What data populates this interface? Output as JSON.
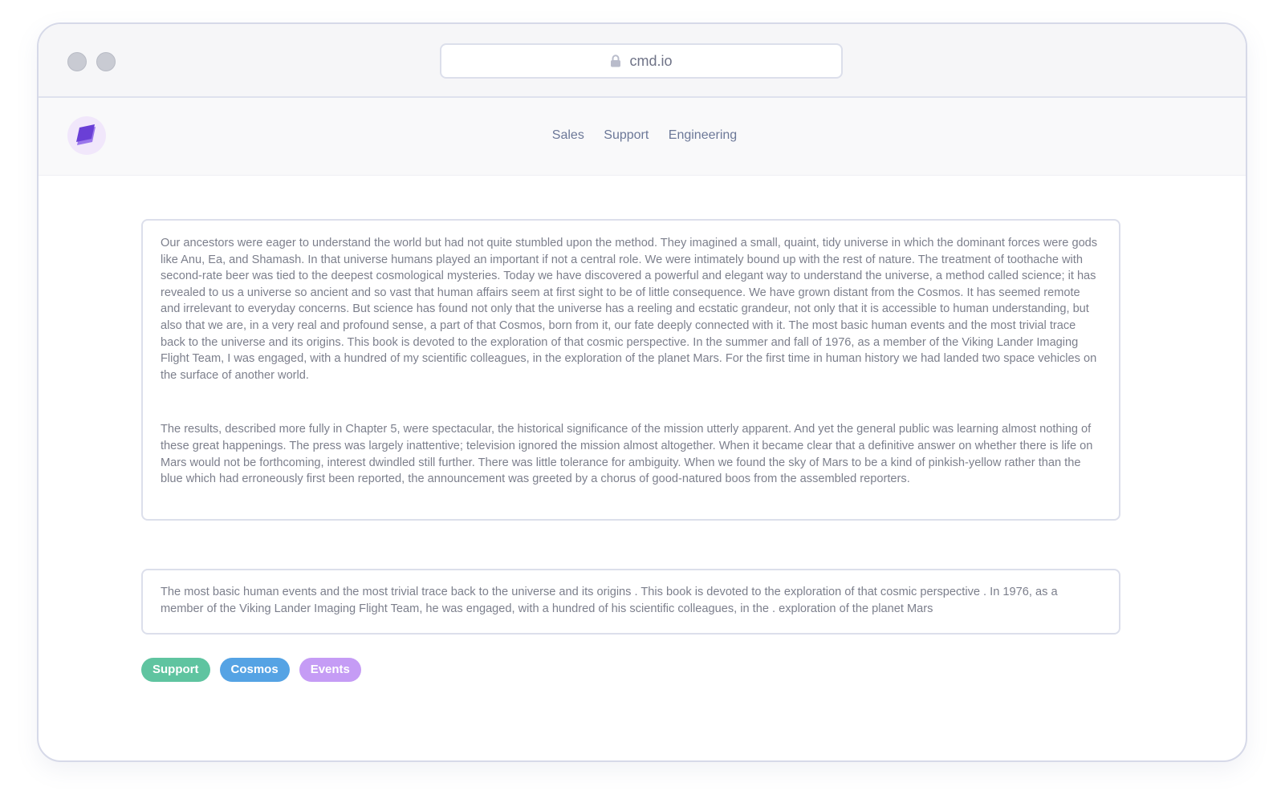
{
  "browser": {
    "url": "cmd.io"
  },
  "nav": {
    "links": [
      "Sales",
      "Support",
      "Engineering"
    ]
  },
  "content": {
    "paragraph1": "Our ancestors were eager to understand the world but had not quite stumbled upon the method. They imagined a small, quaint, tidy universe in which the dominant forces were gods like Anu, Ea, and Shamash. In that universe humans played an important if not a central role. We were intimately bound up with the rest of nature. The treatment of toothache with second-rate beer was tied to the deepest cosmological mysteries.  Today we have discovered a powerful and elegant way to understand the universe, a method called science; it has revealed to us a universe so ancient and so vast that human affairs seem at first sight to be of little consequence. We have grown distant from the Cosmos. It has seemed remote and irrelevant to everyday concerns. But science has found not only that the universe has a reeling and ecstatic grandeur, not only that it is accessible to human understanding, but also that we are, in a very real and profound sense, a part of that Cosmos, born from it, our fate deeply connected with it. The most basic human events and the most trivial trace back to the universe and its origins. This book is devoted to the exploration of that cosmic perspective. In the summer and fall of 1976, as a member of the Viking Lander Imaging Flight Team, I was engaged, with a hundred of my scientific colleagues, in the exploration of the planet Mars. For the first time in human history we had landed two space vehicles on the surface of another world.",
    "paragraph2": "The results, described more fully in Chapter 5, were spectacular, the historical significance of the mission utterly apparent. And yet the general public was learning almost nothing of these great happenings. The press was largely inattentive; television ignored the mission almost altogether. When it became clear that a definitive answer on whether there is life on Mars would not be forthcoming, interest dwindled still further. There was little tolerance for ambiguity. When we found the sky of Mars to be a kind of pinkish-yellow rather than the blue which had erroneously first been reported, the announcement was greeted by a chorus of good-natured boos from the assembled reporters.",
    "summary": "The most basic human events and the most trivial trace back to the universe and its origins . This book is devoted to the exploration of that cosmic perspective . In 1976, as a member of the Viking Lander Imaging Flight Team, he was engaged, with a hundred of his scientific colleagues, in the . exploration of the planet Mars"
  },
  "tags": [
    {
      "label": "Support",
      "color": "#5fc4a0"
    },
    {
      "label": "Cosmos",
      "color": "#55a3e4"
    },
    {
      "label": "Events",
      "color": "#c59cf5"
    }
  ],
  "colors": {
    "logo_primary": "#6a3fd6",
    "logo_secondary": "#9a76ec",
    "logo_bg": "#f1e7fb"
  }
}
